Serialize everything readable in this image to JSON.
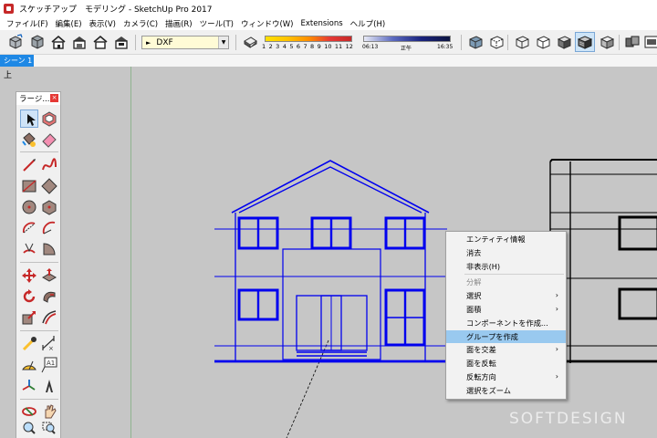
{
  "window": {
    "title": "スケッチアップ　モデリング - SketchUp Pro 2017"
  },
  "menu": [
    {
      "label": "ファイル(F)"
    },
    {
      "label": "編集(E)"
    },
    {
      "label": "表示(V)"
    },
    {
      "label": "カメラ(C)"
    },
    {
      "label": "描画(R)"
    },
    {
      "label": "ツール(T)"
    },
    {
      "label": "ウィンドウ(W)"
    },
    {
      "label": "Extensions"
    },
    {
      "label": "ヘルプ(H)"
    }
  ],
  "toolbar": {
    "views": [
      "standard-views-icon",
      "iso-view-icon",
      "top-view-icon",
      "front-view-icon",
      "right-view-icon",
      "back-view-icon"
    ],
    "layer_select": {
      "value": "DXF"
    },
    "shadow_settings_icon": "shadow-settings-icon",
    "months": [
      "1",
      "2",
      "3",
      "4",
      "5",
      "6",
      "7",
      "8",
      "9",
      "10",
      "11",
      "12"
    ],
    "time_start": "06:13",
    "time_noon": "正午",
    "time_end": "16:35",
    "styles": [
      "xray-icon",
      "back-edges-icon",
      "wireframe-icon",
      "hidden-line-icon",
      "shaded-icon",
      "shaded-textures-icon",
      "monochrome-icon"
    ],
    "selected_style": "shaded-textures-icon"
  },
  "scene": {
    "tab_label": "シーン 1"
  },
  "viewport": {
    "view_name": "上"
  },
  "tool_palette": {
    "title": "ラージ...",
    "close_label": "×",
    "tools": [
      "select-icon",
      "make-component-icon",
      "paint-bucket-icon",
      "eraser-icon",
      "line-icon",
      "freehand-icon",
      "rectangle-icon",
      "rotated-rectangle-icon",
      "circle-icon",
      "polygon-icon",
      "arc-icon",
      "two-point-arc-icon",
      "three-point-arc-icon",
      "pie-icon",
      "move-icon",
      "push-pull-icon",
      "rotate-icon",
      "follow-me-icon",
      "scale-icon",
      "offset-icon",
      "tape-measure-icon",
      "dimension-icon",
      "protractor-icon",
      "text-icon",
      "axes-icon",
      "3d-text-icon",
      "orbit-icon",
      "pan-icon",
      "zoom-icon",
      "zoom-window-icon"
    ],
    "selected_tool": "select-icon"
  },
  "context_menu": {
    "items": [
      {
        "label": "エンティティ情報",
        "name": "cm-entity-info",
        "enabled": true,
        "submenu": false
      },
      {
        "label": "消去",
        "name": "cm-erase",
        "enabled": true,
        "submenu": false
      },
      {
        "label": "非表示(H)",
        "name": "cm-hide",
        "enabled": true,
        "submenu": false
      },
      {
        "separator": true
      },
      {
        "label": "分解",
        "name": "cm-explode",
        "enabled": false,
        "submenu": false
      },
      {
        "label": "選択",
        "name": "cm-select",
        "enabled": true,
        "submenu": true
      },
      {
        "label": "面積",
        "name": "cm-area",
        "enabled": true,
        "submenu": true
      },
      {
        "label": "コンポーネントを作成...",
        "name": "cm-make-component",
        "enabled": true,
        "submenu": false
      },
      {
        "label": "グループを作成",
        "name": "cm-make-group",
        "enabled": true,
        "submenu": false,
        "highlighted": true
      },
      {
        "label": "面を交差",
        "name": "cm-intersect-faces",
        "enabled": true,
        "submenu": true
      },
      {
        "label": "面を反転",
        "name": "cm-reverse-faces",
        "enabled": true,
        "submenu": false
      },
      {
        "label": "反転方向",
        "name": "cm-flip-along",
        "enabled": true,
        "submenu": true
      },
      {
        "label": "選択をズーム",
        "name": "cm-zoom-selection",
        "enabled": true,
        "submenu": false
      }
    ],
    "submenu_arrow": "›"
  },
  "watermark": "SOFTDESIGN",
  "colors": {
    "selection_blue": "#0000ee",
    "menu_highlight": "#99c9ef",
    "scene_tab": "#1e88e5"
  }
}
